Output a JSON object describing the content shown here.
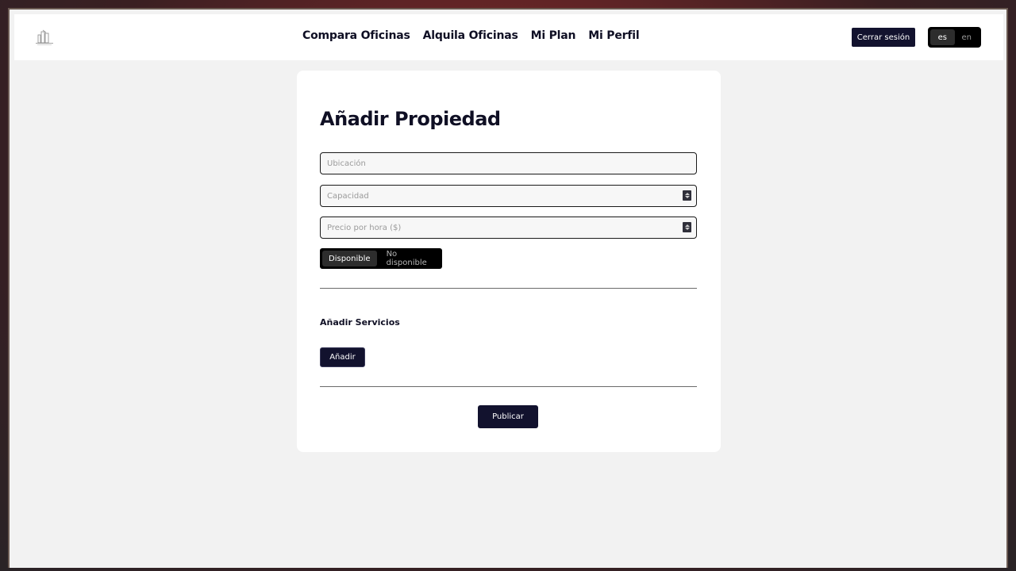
{
  "nav": {
    "links": [
      "Compara Oficinas",
      "Alquila Oficinas",
      "Mi Plan",
      "Mi Perfil"
    ],
    "logout_label": "Cerrar sesión",
    "languages": [
      "es",
      "en"
    ],
    "active_language": "es"
  },
  "form": {
    "title": "Añadir Propiedad",
    "location_placeholder": "Ubicación",
    "capacity_placeholder": "Capacidad",
    "price_placeholder": "Precio por hora ($)",
    "availability": {
      "options": [
        "Disponible",
        "No disponible"
      ],
      "selected": "Disponible"
    },
    "services_title": "Añadir Servicios",
    "add_label": "Añadir",
    "publish_label": "Publicar"
  },
  "colors": {
    "primary": "#12122e",
    "background": "#f2f2f2",
    "card": "#ffffff"
  }
}
